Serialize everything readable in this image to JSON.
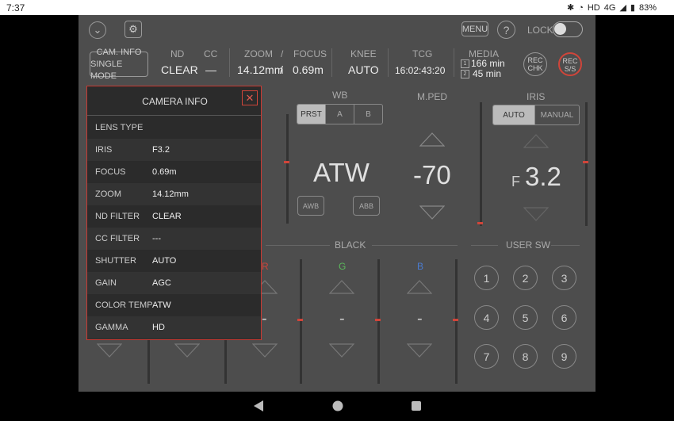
{
  "status_bar": {
    "time": "7:37",
    "network": "HD",
    "signal": "4G",
    "battery": "83%"
  },
  "top": {
    "menu_label": "MENU",
    "help_label": "?",
    "lock_label": "LOCK"
  },
  "mode": {
    "line1": "CAM. INFO",
    "line2": "SINGLE MODE"
  },
  "info": {
    "nd_label": "ND",
    "nd_value": "CLEAR",
    "cc_label": "CC",
    "cc_value": "—",
    "zoom_label": "ZOOM",
    "slash1": "/",
    "focus_label": "FOCUS",
    "zoom_value": "14.12mm",
    "slash2": "/",
    "focus_value": "0.69m",
    "knee_label": "KNEE",
    "knee_value": "AUTO",
    "tcg_label": "TCG",
    "tcg_value": "16:02:43:20",
    "media_label": "MEDIA",
    "media1_num": "1",
    "media1": "166 min",
    "media2_num": "2",
    "media2": "45 min"
  },
  "rec": {
    "chk_line1": "REC",
    "chk_line2": "CHK",
    "ss_line1": "REC",
    "ss_line2": "S/S"
  },
  "wb": {
    "title": "WB",
    "tabs": [
      "PRST",
      "A",
      "B"
    ],
    "value": "ATW",
    "awb": "AWB",
    "abb": "ABB"
  },
  "mped": {
    "title": "M.PED",
    "value": "-70"
  },
  "iris": {
    "title": "IRIS",
    "tabs": [
      "AUTO",
      "MANUAL"
    ],
    "prefix": "F",
    "value": "3.2"
  },
  "black": {
    "title": "BLACK",
    "r_label": "R",
    "g_label": "G",
    "b_label": "B",
    "r_value": "-",
    "g_value": "-",
    "b_value": "-"
  },
  "user_sw": {
    "title": "USER SW",
    "buttons": [
      "1",
      "2",
      "3",
      "4",
      "5",
      "6",
      "7",
      "8",
      "9"
    ]
  },
  "dialog": {
    "title": "CAMERA INFO",
    "rows": [
      {
        "key": "LENS TYPE",
        "value": ""
      },
      {
        "key": "IRIS",
        "value": "F3.2"
      },
      {
        "key": "FOCUS",
        "value": "0.69m"
      },
      {
        "key": "ZOOM",
        "value": "14.12mm"
      },
      {
        "key": "ND FILTER",
        "value": "CLEAR"
      },
      {
        "key": "CC FILTER",
        "value": "---"
      },
      {
        "key": "SHUTTER",
        "value": "AUTO"
      },
      {
        "key": "GAIN",
        "value": "AGC"
      },
      {
        "key": "COLOR TEMP",
        "value": "ATW"
      },
      {
        "key": "GAMMA",
        "value": "HD"
      }
    ]
  },
  "colors": {
    "accent_red": "#d0453a",
    "g_color": "#5cb85c",
    "b_color": "#4a7bd0",
    "r_color": "#d0453a"
  }
}
